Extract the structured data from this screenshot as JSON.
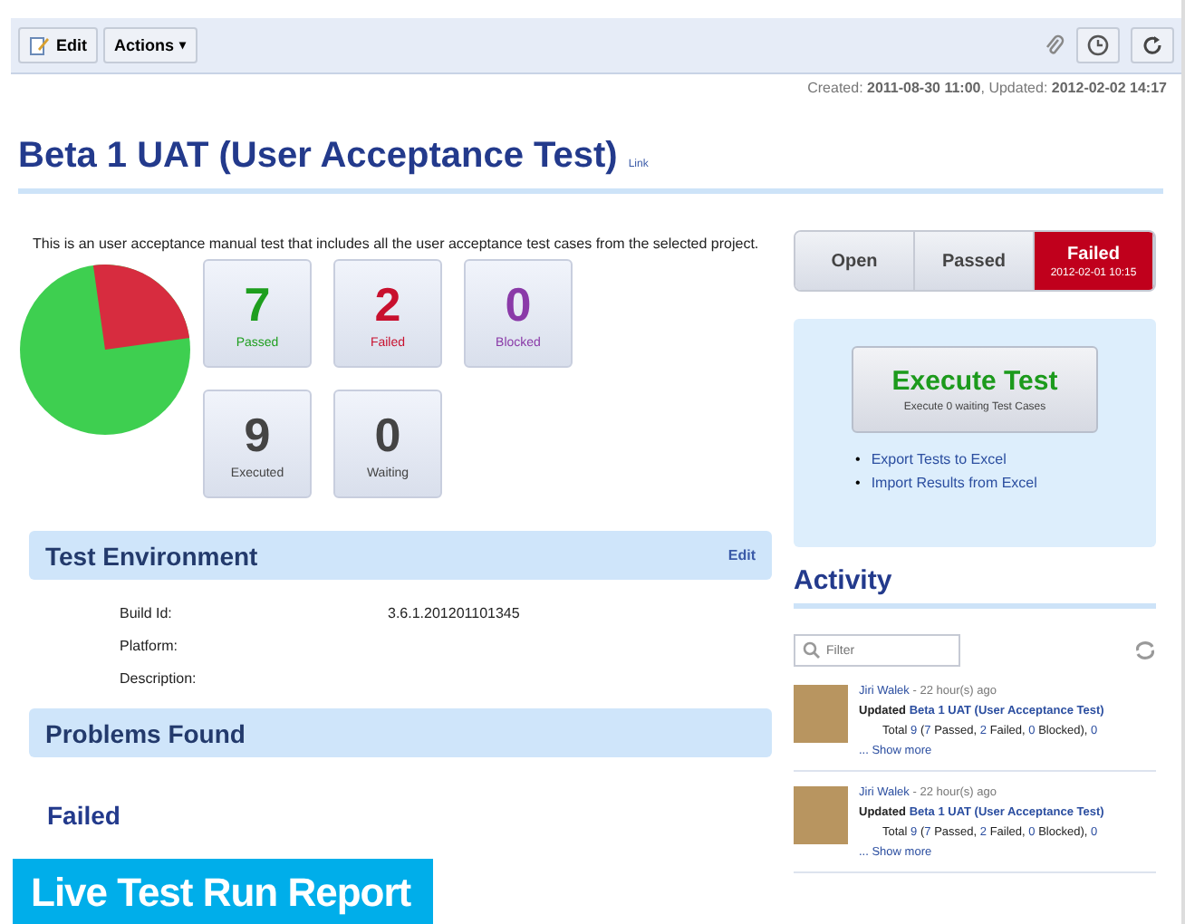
{
  "toolbar": {
    "buttons": [
      {
        "label": "Edit",
        "kind": "edit"
      },
      {
        "label": "Actions",
        "kind": "menu",
        "caret": "▾"
      }
    ]
  },
  "meta": {
    "created_label": "Created:",
    "created": "2011-08-30 11:00",
    "updated_label": ", Updated:",
    "updated": "2012-02-02 14:17"
  },
  "title": "Beta 1 UAT (User Acceptance Test)",
  "title_link": "Link",
  "description": "This is an user acceptance manual test  that  includes all the user acceptance test cases from the selected project.",
  "stats": [
    {
      "value": "7",
      "label": "Passed",
      "color": "#1e9e1e"
    },
    {
      "value": "2",
      "label": "Failed",
      "color": "#c8102e"
    },
    {
      "value": "0",
      "label": "Blocked",
      "color": "#8a3aa8"
    },
    {
      "value": "9",
      "label": "Executed",
      "color": "#444444"
    },
    {
      "value": "0",
      "label": "Waiting",
      "color": "#444444"
    }
  ],
  "status": [
    {
      "label": "Open",
      "selected": false
    },
    {
      "label": "Passed",
      "selected": false
    },
    {
      "label": "Failed",
      "selected": true,
      "date": "2012-02-01 10:15"
    }
  ],
  "execute": {
    "label": "Execute Test",
    "sub": "Execute 0 waiting Test Cases"
  },
  "links": [
    {
      "bullet": "•",
      "label": "Export Tests to Excel"
    },
    {
      "bullet": "•",
      "label": "Import Results from Excel"
    }
  ],
  "environment": {
    "title": "Test Environment",
    "edit": "Edit",
    "fields": [
      {
        "label": "Build Id:",
        "value": "3.6.1.201201101345"
      },
      {
        "label": "Platform:"
      },
      {
        "label": "Description:"
      }
    ]
  },
  "problems": {
    "title": "Problems Found",
    "subtitle": "Failed"
  },
  "activity": {
    "title": "Activity",
    "filter_placeholder": "Filter",
    "items": [
      {
        "author": "Jiri Walek",
        "time": " - 22 hour(s) ago",
        "action": "Updated",
        "target": "Beta 1 UAT (User Acceptance Test)",
        "summary": [
          {
            "t": "Total ",
            "link": false
          },
          {
            "t": "9",
            "link": true
          },
          {
            "t": " (",
            "link": false
          },
          {
            "t": "7",
            "link": true
          },
          {
            "t": " Passed, ",
            "link": false
          },
          {
            "t": "2",
            "link": true
          },
          {
            "t": " Failed, ",
            "link": false
          },
          {
            "t": "0",
            "link": true
          },
          {
            "t": " Blocked), ",
            "link": false
          },
          {
            "t": "0",
            "link": true
          }
        ],
        "more": "... Show more"
      },
      {
        "author": "Jiri Walek",
        "time": " - 22 hour(s) ago",
        "action": "Updated",
        "target": "Beta 1 UAT (User Acceptance Test)",
        "summary": [
          {
            "t": "Total ",
            "link": false
          },
          {
            "t": "9",
            "link": true
          },
          {
            "t": " (",
            "link": false
          },
          {
            "t": "7",
            "link": true
          },
          {
            "t": " Passed, ",
            "link": false
          },
          {
            "t": "2",
            "link": true
          },
          {
            "t": " Failed, ",
            "link": false
          },
          {
            "t": "0",
            "link": true
          },
          {
            "t": " Blocked), ",
            "link": false
          },
          {
            "t": "0",
            "link": true
          }
        ],
        "more": "... Show more"
      }
    ]
  },
  "caption": "Live Test Run Report"
}
